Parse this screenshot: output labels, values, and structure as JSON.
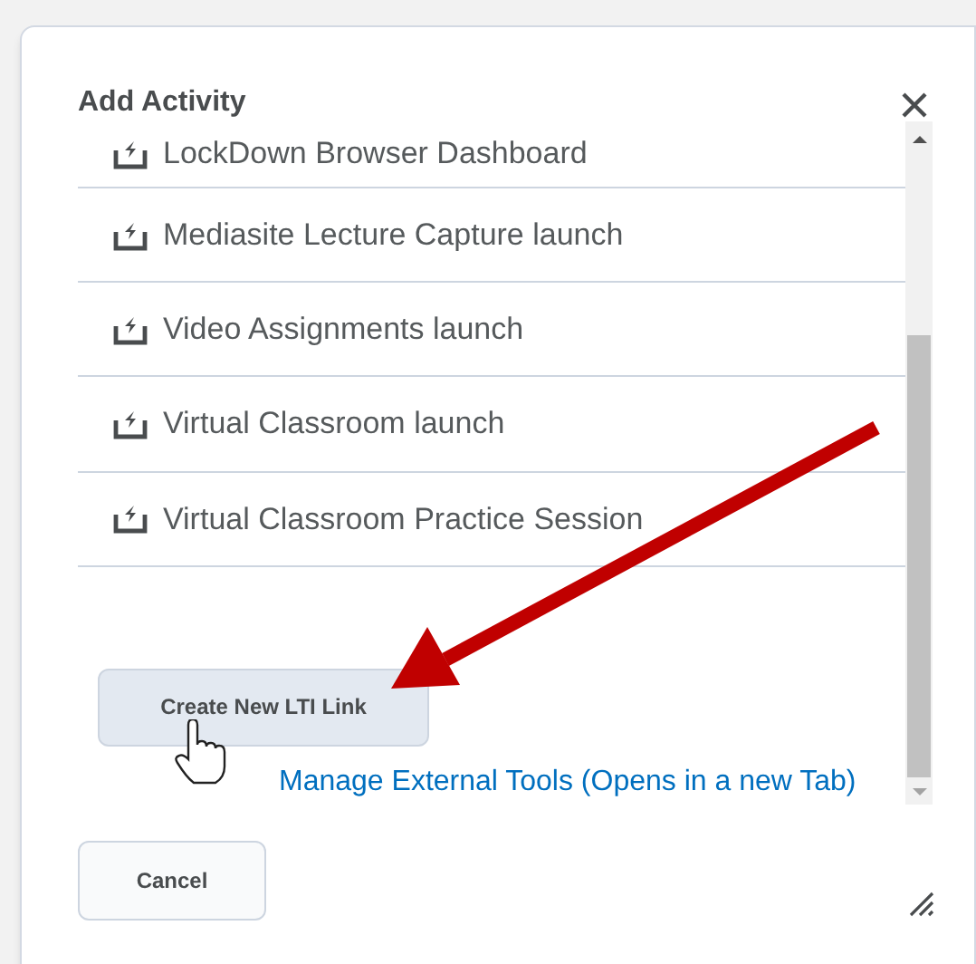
{
  "dialog": {
    "title": "Add Activity"
  },
  "items": [
    {
      "label": "LockDown Browser Dashboard"
    },
    {
      "label": "Mediasite Lecture Capture launch"
    },
    {
      "label": "Video Assignments launch"
    },
    {
      "label": "Virtual Classroom launch"
    },
    {
      "label": "Virtual Classroom Practice Session"
    }
  ],
  "create_button": "Create New LTI Link",
  "manage_link": "Manage External Tools (Opens in a new Tab)",
  "cancel_button": "Cancel"
}
